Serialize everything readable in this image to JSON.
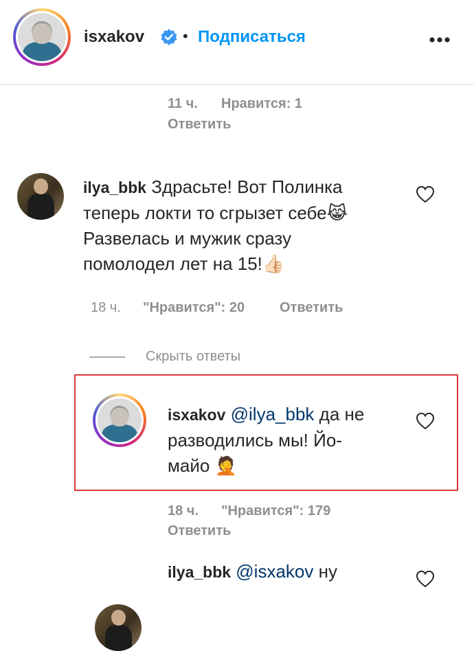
{
  "header": {
    "username": "isxakov",
    "dot": "•",
    "follow_label": "Подписаться",
    "more_icon": "more-icon",
    "verified_icon": "verified-badge-icon"
  },
  "top_comment_meta": {
    "time": "11 ч.",
    "likes": "Нравится: 1",
    "reply": "Ответить"
  },
  "comment_ilya": {
    "username": "ilya_bbk",
    "text_lines": [
      "Здрасьте! Вот Полинка",
      "теперь локти то сгрызет себе",
      "Развелась и мужик сразу",
      "помолодел лет на 15!"
    ],
    "emoji_1": "😹",
    "emoji_2": "👍🏻",
    "time": "18 ч.",
    "likes": "\"Нравится\": 20",
    "reply": "Ответить",
    "hide_replies": "Скрыть ответы"
  },
  "reply_isxakov": {
    "username": "isxakov",
    "mention": "@ilya_bbk",
    "text_line1": "да не",
    "text_line2": "разводились мы! Йо-",
    "text_line3": "майо",
    "emoji": "🤦",
    "time": "18 ч.",
    "likes": "\"Нравится\": 179",
    "reply": "Ответить"
  },
  "reply_ilya": {
    "username": "ilya_bbk",
    "mention": "@isxakov",
    "text": "ну"
  },
  "colors": {
    "follow_blue": "#0095f6",
    "highlight_red": "#d93a3a",
    "mention_blue": "#00376b"
  }
}
